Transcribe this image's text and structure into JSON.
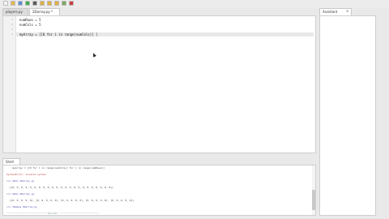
{
  "toolbar": {
    "buttons": [
      {
        "name": "new-file-icon",
        "color": "#f5f5f5"
      },
      {
        "name": "open-folder-icon",
        "color": "#e4b94b"
      },
      {
        "name": "save-icon",
        "color": "#5a8ed8"
      },
      {
        "name": "run-icon",
        "color": "#3fae4a"
      },
      {
        "name": "debug-icon",
        "color": "#5c5c5c"
      },
      {
        "name": "step-over-icon",
        "color": "#e0b040"
      },
      {
        "name": "step-into-icon",
        "color": "#e0b040"
      },
      {
        "name": "step-out-icon",
        "color": "#e0b040"
      },
      {
        "name": "resume-icon",
        "color": "#7aa65a"
      },
      {
        "name": "stop-icon",
        "color": "#d23c3c"
      }
    ]
  },
  "tabs": [
    {
      "label": "players.py",
      "active": false
    },
    {
      "label": "2Darray.py *",
      "active": true
    }
  ],
  "editor": {
    "lines": [
      {
        "num": "1",
        "text": "numRows = 5"
      },
      {
        "num": "2",
        "text": "numCols = 5"
      },
      {
        "num": "3",
        "text": ""
      },
      {
        "num": "4",
        "text": "myArray = [[0 for i in range(numCols)] ]"
      }
    ]
  },
  "assistant": {
    "label": "Assistant"
  },
  "shell": {
    "label": "Shell",
    "lines": [
      {
        "text": "    myArray = [[0 for i in range(numCols)] for j in range(numRows)]",
        "kind": "normal"
      },
      {
        "text": "SyntaxError: invalid syntax",
        "kind": "err"
      },
      {
        "text": ">>> %Run 2Darray.py",
        "kind": "prompt"
      },
      {
        "text": "  [[0, 0, 0, 0, 0, 0, 0, 0, 0, 0, 0, 0, 0, 0, 0, 0, 0, 0, 0, 0, 0, 0, 0]]",
        "kind": "normal"
      },
      {
        "text": ">>> %Run 2Darray.py",
        "kind": "prompt"
      },
      {
        "text": "  [[0, 0, 0, 0, 0], [0, 0, 0, 0, 0], [0, 0, 0, 0, 0], [0, 0, 0, 0, 0], [0, 0, 0, 0, 0]]",
        "kind": "normal"
      },
      {
        "text": ">>> %Debug 2Darray.py",
        "kind": "prompt"
      },
      {
        "text": "─────────────────────────── RESTART ───────────────────────────",
        "kind": "run"
      }
    ]
  }
}
